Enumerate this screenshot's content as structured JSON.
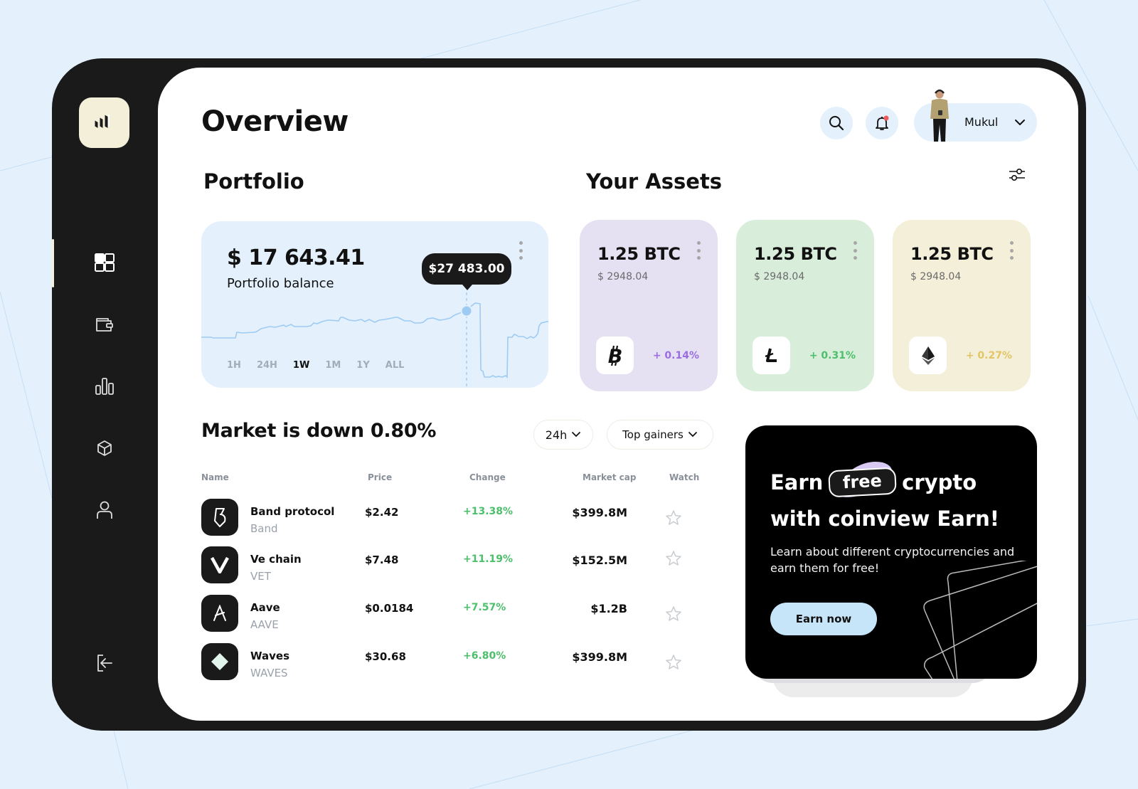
{
  "header": {
    "title": "Overview",
    "user_name": "Mukul",
    "notification_dot_color": "#f25a5a"
  },
  "sidebar": {
    "items": [
      {
        "icon": "dashboard-icon",
        "active": true
      },
      {
        "icon": "wallet-icon",
        "active": false
      },
      {
        "icon": "bar-chart-icon",
        "active": false
      },
      {
        "icon": "cube-icon",
        "active": false
      },
      {
        "icon": "user-icon",
        "active": false
      }
    ],
    "logout_icon": "logout-icon"
  },
  "portfolio": {
    "section_title": "Portfolio",
    "balance": "$ 17 643.41",
    "balance_label": "Portfolio balance",
    "tooltip_value": "$27 483.00",
    "ranges": [
      {
        "label": "1H",
        "active": false
      },
      {
        "label": "24H",
        "active": false
      },
      {
        "label": "1W",
        "active": true
      },
      {
        "label": "1M",
        "active": false
      },
      {
        "label": "1Y",
        "active": false
      },
      {
        "label": "ALL",
        "active": false
      }
    ],
    "line_color": "#9dcbf3"
  },
  "assets": {
    "section_title": "Your Assets",
    "cards": [
      {
        "amount": "1.25 BTC",
        "usd": "$ 2948.04",
        "change": "+ 0.14%",
        "coin": "bitcoin",
        "bg": "#e6e0f3",
        "change_color": "#9a6ee0"
      },
      {
        "amount": "1.25 BTC",
        "usd": "$ 2948.04",
        "change": "+ 0.31%",
        "coin": "litecoin",
        "bg": "#d8eedb",
        "change_color": "#4cbf6a"
      },
      {
        "amount": "1.25 BTC",
        "usd": "$ 2948.04",
        "change": "+ 0.27%",
        "coin": "ethereum",
        "bg": "#f4efd9",
        "change_color": "#e2c566"
      }
    ]
  },
  "market": {
    "title": "Market is  down 0.80%",
    "period_dropdown": "24h",
    "filter_dropdown": "Top gainers",
    "columns": [
      "Name",
      "Price",
      "Change",
      "Market cap",
      "Watch"
    ],
    "rows": [
      {
        "name": "Band protocol",
        "symbol": "Band",
        "price": "$2.42",
        "change": "+13.38%",
        "market_cap": "$399.8M"
      },
      {
        "name": "Ve chain",
        "symbol": "VET",
        "price": "$7.48",
        "change": "+11.19%",
        "market_cap": "$152.5M"
      },
      {
        "name": "Aave",
        "symbol": "AAVE",
        "price": "$0.0184",
        "change": "+7.57%",
        "market_cap": "$1.2B"
      },
      {
        "name": "Waves",
        "symbol": "WAVES",
        "price": "$30.68",
        "change": "+6.80%",
        "market_cap": "$399.8M"
      }
    ]
  },
  "promo": {
    "line1_before": "Earn",
    "highlight": "free",
    "line1_after": "crypto",
    "line2": "with coinview Earn!",
    "description": "Learn about different cryptocurrencies and earn them for free!",
    "button_label": "Earn now"
  }
}
